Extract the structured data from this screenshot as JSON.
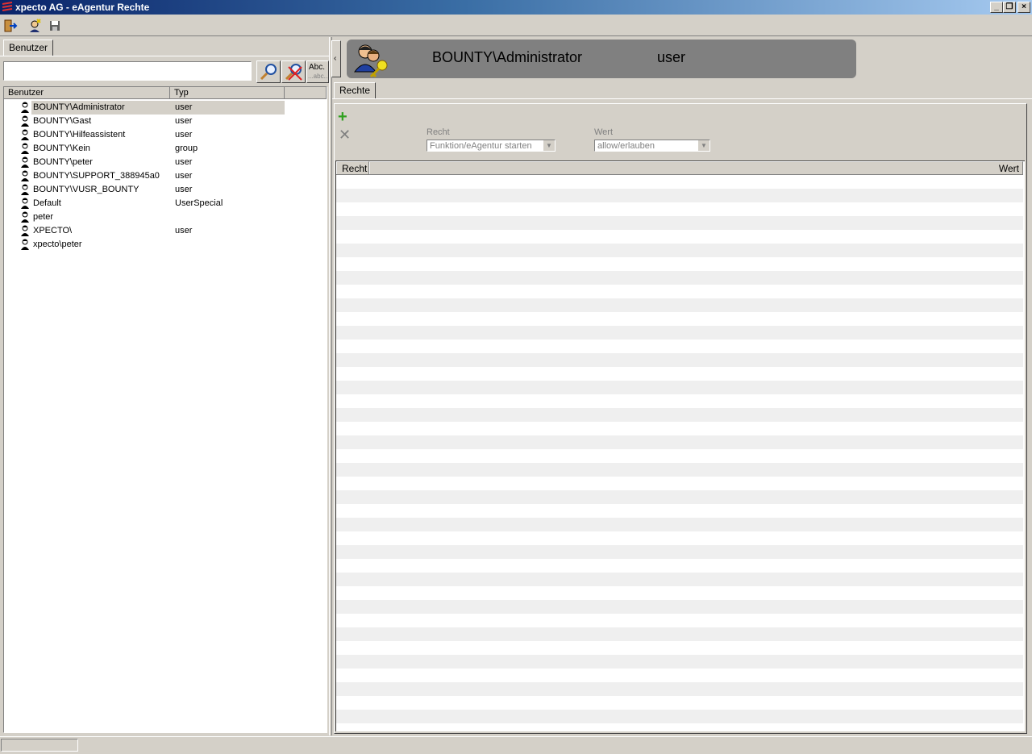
{
  "window": {
    "title": "xpecto AG - eAgentur Rechte",
    "buttons": {
      "minimize": "_",
      "restore": "❐",
      "close": "×"
    }
  },
  "toolbar": {
    "icons": [
      "exit-icon",
      "new-user-icon",
      "save-icon"
    ]
  },
  "left_panel": {
    "tab_label": "Benutzer",
    "search": {
      "value": "",
      "placeholder": ""
    },
    "search_buttons": {
      "abc_label": "Abc.",
      "abc_sub_label": "...abc..."
    },
    "columns": [
      "Benutzer",
      "Typ"
    ],
    "rows": [
      {
        "name": "BOUNTY\\Administrator",
        "type": "user",
        "selected": true
      },
      {
        "name": "BOUNTY\\Gast",
        "type": "user"
      },
      {
        "name": "BOUNTY\\Hilfeassistent",
        "type": "user"
      },
      {
        "name": "BOUNTY\\Kein",
        "type": "group"
      },
      {
        "name": "BOUNTY\\peter",
        "type": "user"
      },
      {
        "name": "BOUNTY\\SUPPORT_388945a0",
        "type": "user"
      },
      {
        "name": "BOUNTY\\VUSR_BOUNTY",
        "type": "user"
      },
      {
        "name": "Default",
        "type": "UserSpecial"
      },
      {
        "name": "peter",
        "type": ""
      },
      {
        "name": "XPECTO\\",
        "type": "user"
      },
      {
        "name": "xpecto\\peter",
        "type": ""
      }
    ]
  },
  "right_panel": {
    "header": {
      "user_name": "BOUNTY\\Administrator",
      "user_type": "user"
    },
    "tab_label": "Rechte",
    "editor": {
      "recht_label": "Recht",
      "recht_value": "Funktion/eAgentur starten",
      "wert_label": "Wert",
      "wert_value": "allow/erlauben"
    },
    "grid": {
      "columns": [
        "Recht",
        "Wert"
      ],
      "rows": []
    }
  },
  "status_bar": {
    "text": ""
  },
  "colors": {
    "title_gradient_start": "#0a246a",
    "title_gradient_end": "#a6caf0",
    "face": "#d4d0c8",
    "header_card": "#808080",
    "grid_stripe": "#efefef"
  }
}
